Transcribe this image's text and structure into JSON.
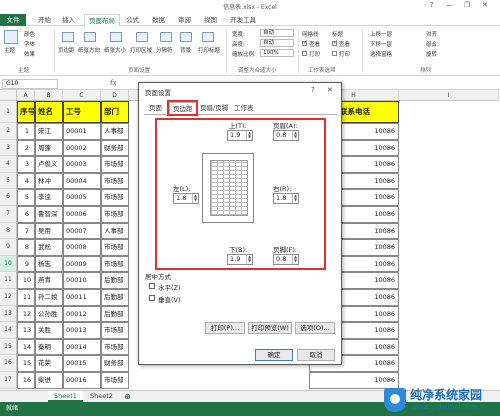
{
  "window": {
    "title": "信息表.xlsx - Excel",
    "help": "?",
    "minimize": "—",
    "restore": "❐",
    "close": "✕"
  },
  "ribbon": {
    "tabs": [
      "文件",
      "开始",
      "插入",
      "页面布局",
      "公式",
      "数据",
      "审阅",
      "视图",
      "开发工具"
    ],
    "active_tab": "页面布局",
    "theme": {
      "themes": "主题",
      "colors": "颜色",
      "fonts": "字体",
      "effects": "效果",
      "group": "主题"
    },
    "page_setup": {
      "margins": "页边距",
      "orientation": "纸张方向",
      "size": "纸张大小",
      "print_area": "打印区域",
      "breaks": "分隔符",
      "background": "背景",
      "print_titles": "打印标题",
      "group": "页面设置"
    },
    "scale": {
      "width_label": "宽度:",
      "width": "自动",
      "height_label": "高度:",
      "height": "自动",
      "scale_label": "缩放比例:",
      "scale": "100%",
      "group": "调整为合适大小"
    },
    "sheet_options": {
      "gridlines": "网格线",
      "headings": "标题",
      "view": "查看",
      "print": "打印",
      "group": "工作表选项"
    },
    "arrange": {
      "bring_forward": "上移一层",
      "send_backward": "下移一层",
      "selection_pane": "选择窗格",
      "align": "对齐",
      "group_btn": "组合",
      "rotate": "旋转",
      "group": "排列"
    }
  },
  "formula_bar": {
    "name_box": "G10",
    "fx": "fx"
  },
  "grid": {
    "columns": [
      "A",
      "B",
      "C",
      "D",
      "E",
      "F",
      "G",
      "H",
      "I"
    ],
    "row_numbers": [
      "1",
      "2",
      "3",
      "4",
      "5",
      "6",
      "7",
      "8",
      "9",
      "10",
      "11",
      "12",
      "13",
      "14",
      "15",
      "16",
      "17"
    ],
    "header_row": [
      "序号",
      "姓名",
      "工号",
      "部门",
      "",
      "",
      "",
      "联系电话"
    ],
    "rows": [
      [
        "1",
        "宋江",
        "00001",
        "人事部",
        "10086"
      ],
      [
        "2",
        "周蓬",
        "00002",
        "财务部",
        "10086"
      ],
      [
        "3",
        "卢俊义",
        "00003",
        "市场部",
        "10086"
      ],
      [
        "4",
        "林冲",
        "00004",
        "市场部",
        "10086"
      ],
      [
        "5",
        "李逵",
        "00005",
        "市场部",
        "10086"
      ],
      [
        "6",
        "鲁智深",
        "00006",
        "市场部",
        "10086"
      ],
      [
        "7",
        "吴用",
        "00007",
        "人事部",
        "10086"
      ],
      [
        "8",
        "武松",
        "00008",
        "市场部",
        "10086"
      ],
      [
        "9",
        "杨志",
        "00009",
        "市场部",
        "10086"
      ],
      [
        "10",
        "燕青",
        "00010",
        "后勤部",
        "10086"
      ],
      [
        "11",
        "孙二娘",
        "00011",
        "后勤部",
        "10086"
      ],
      [
        "12",
        "公孙胜",
        "00012",
        "后勤部",
        "10086"
      ],
      [
        "13",
        "关胜",
        "00013",
        "市场部",
        "10086"
      ],
      [
        "14",
        "秦明",
        "00014",
        "市场部",
        "10086"
      ],
      [
        "15",
        "花荣",
        "00015",
        "财务部",
        "10086"
      ],
      [
        "16",
        "柴进",
        "00016",
        "市场部",
        "10086"
      ]
    ]
  },
  "sheets": {
    "tabs": [
      "Sheet1",
      "Sheet2"
    ],
    "active": "Sheet1",
    "add": "⊕"
  },
  "status": {
    "text": "就绪"
  },
  "dialog": {
    "title": "页面设置",
    "help": "?",
    "close": "✕",
    "tabs": [
      "页面",
      "页边距",
      "页眉/页脚",
      "工作表"
    ],
    "active_tab": "页边距",
    "top_label": "上(T):",
    "top": "1.9",
    "header_label": "页眉(A):",
    "header": "0.8",
    "left_label": "左(L):",
    "left": "1.8",
    "right_label": "右(R):",
    "right": "1.8",
    "bottom_label": "下(B):",
    "bottom": "1.9",
    "footer_label": "页脚(F):",
    "footer": "0.8",
    "center_label": "居中方式",
    "horizontal": "水平(Z)",
    "vertical": "垂直(V)",
    "print_btn": "打印(P)...",
    "preview_btn": "打印预览(W)",
    "options_btn": "选项(O)...",
    "ok_btn": "确定",
    "cancel_btn": "取消"
  },
  "watermark": {
    "name": "纯净系统家园",
    "url": "www.yidaimei.com"
  }
}
